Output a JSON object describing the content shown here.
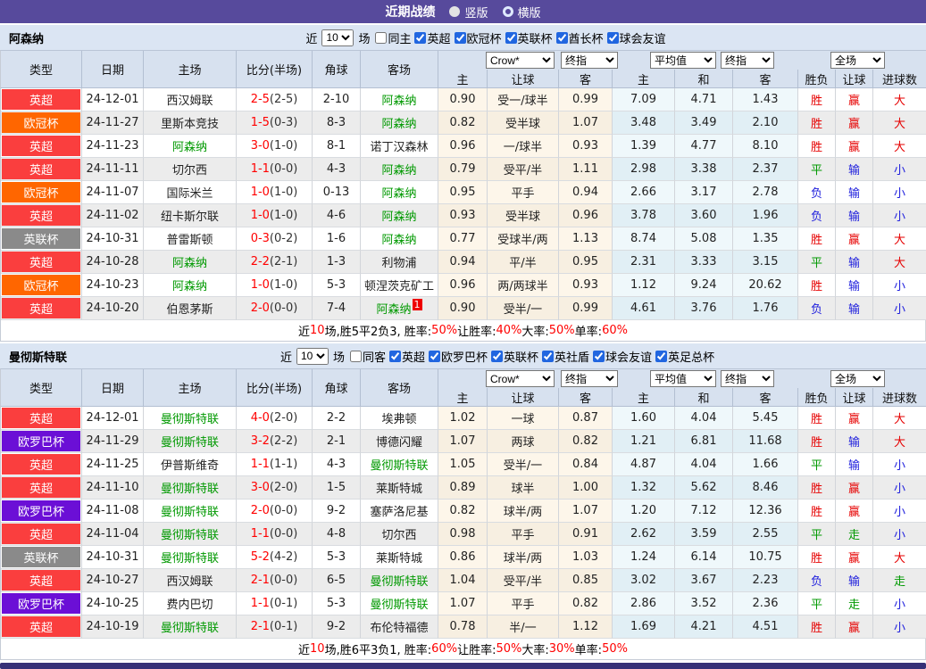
{
  "title_bar": {
    "title": "近期战绩",
    "radio_vertical": "竖版",
    "radio_horizontal": "横版"
  },
  "colors": {
    "league": {
      "英超": "#fa3e3e",
      "欧冠杯": "#ff6600",
      "英联杯": "#8a8a8a",
      "欧罗巴杯": "#6b0fd6"
    },
    "result": {
      "胜": "#e60000",
      "平": "#009900",
      "负": "#2020dd",
      "赢": "#e60000",
      "输": "#2020dd",
      "走": "#009900",
      "大": "#e60000",
      "小": "#2020dd"
    },
    "score_red": "#ff0000",
    "team_green": "#009900",
    "summary_red": "#ff0000"
  },
  "table_header": {
    "cols": [
      "类型",
      "日期",
      "主场",
      "比分(半场)",
      "角球",
      "客场"
    ],
    "odds_cols": [
      "主",
      "让球",
      "客"
    ],
    "avg_cols": [
      "主",
      "和",
      "客"
    ],
    "result_cols": [
      "胜负",
      "让球",
      "进球数"
    ],
    "dropdowns": [
      "Crow*",
      "终指",
      "平均值",
      "终指",
      "全场"
    ]
  },
  "sections": [
    {
      "team": "阿森纳",
      "filters": {
        "near_label": "近",
        "matches_value": "10",
        "field_label": "场",
        "same_label": "同主",
        "same_checked": false,
        "leagues": [
          "英超",
          "欧冠杯",
          "英联杯",
          "酋长杯",
          "球会友谊"
        ]
      },
      "rows": [
        {
          "league": "英超",
          "date": "24-12-01",
          "home": "西汉姆联",
          "score": "2-5",
          "half": "(2-5)",
          "corner": "2-10",
          "away": "阿森纳",
          "o1": "0.90",
          "handicap": "受一/球半",
          "o2": "0.99",
          "a1": "7.09",
          "a2": "4.71",
          "a3": "1.43",
          "r1": "胜",
          "r2": "赢",
          "r3": "大"
        },
        {
          "league": "欧冠杯",
          "date": "24-11-27",
          "home": "里斯本竞技",
          "score": "1-5",
          "half": "(0-3)",
          "corner": "8-3",
          "away": "阿森纳",
          "o1": "0.82",
          "handicap": "受半球",
          "o2": "1.07",
          "a1": "3.48",
          "a2": "3.49",
          "a3": "2.10",
          "r1": "胜",
          "r2": "赢",
          "r3": "大"
        },
        {
          "league": "英超",
          "date": "24-11-23",
          "home": "阿森纳",
          "score": "3-0",
          "half": "(1-0)",
          "corner": "8-1",
          "away": "诺丁汉森林",
          "o1": "0.96",
          "handicap": "一/球半",
          "o2": "0.93",
          "a1": "1.39",
          "a2": "4.77",
          "a3": "8.10",
          "r1": "胜",
          "r2": "赢",
          "r3": "大"
        },
        {
          "league": "英超",
          "date": "24-11-11",
          "home": "切尔西",
          "score": "1-1",
          "half": "(0-0)",
          "corner": "4-3",
          "away": "阿森纳",
          "o1": "0.79",
          "handicap": "受平/半",
          "o2": "1.11",
          "a1": "2.98",
          "a2": "3.38",
          "a3": "2.37",
          "r1": "平",
          "r2": "输",
          "r3": "小"
        },
        {
          "league": "欧冠杯",
          "date": "24-11-07",
          "home": "国际米兰",
          "score": "1-0",
          "half": "(1-0)",
          "corner": "0-13",
          "away": "阿森纳",
          "o1": "0.95",
          "handicap": "平手",
          "o2": "0.94",
          "a1": "2.66",
          "a2": "3.17",
          "a3": "2.78",
          "r1": "负",
          "r2": "输",
          "r3": "小"
        },
        {
          "league": "英超",
          "date": "24-11-02",
          "home": "纽卡斯尔联",
          "score": "1-0",
          "half": "(1-0)",
          "corner": "4-6",
          "away": "阿森纳",
          "o1": "0.93",
          "handicap": "受半球",
          "o2": "0.96",
          "a1": "3.78",
          "a2": "3.60",
          "a3": "1.96",
          "r1": "负",
          "r2": "输",
          "r3": "小"
        },
        {
          "league": "英联杯",
          "date": "24-10-31",
          "home": "普雷斯顿",
          "score": "0-3",
          "half": "(0-2)",
          "corner": "1-6",
          "away": "阿森纳",
          "o1": "0.77",
          "handicap": "受球半/两",
          "o2": "1.13",
          "a1": "8.74",
          "a2": "5.08",
          "a3": "1.35",
          "r1": "胜",
          "r2": "赢",
          "r3": "大"
        },
        {
          "league": "英超",
          "date": "24-10-28",
          "home": "阿森纳",
          "score": "2-2",
          "half": "(2-1)",
          "corner": "1-3",
          "away": "利物浦",
          "o1": "0.94",
          "handicap": "平/半",
          "o2": "0.95",
          "a1": "2.31",
          "a2": "3.33",
          "a3": "3.15",
          "r1": "平",
          "r2": "输",
          "r3": "大"
        },
        {
          "league": "欧冠杯",
          "date": "24-10-23",
          "home": "阿森纳",
          "score": "1-0",
          "half": "(1-0)",
          "corner": "5-3",
          "away": "顿涅茨克矿工",
          "o1": "0.96",
          "handicap": "两/两球半",
          "o2": "0.93",
          "a1": "1.12",
          "a2": "9.24",
          "a3": "20.62",
          "r1": "胜",
          "r2": "输",
          "r3": "小"
        },
        {
          "league": "英超",
          "date": "24-10-20",
          "home": "伯恩茅斯",
          "score": "2-0",
          "half": "(0-0)",
          "corner": "7-4",
          "away": "阿森纳",
          "away_sup": "1",
          "o1": "0.90",
          "handicap": "受半/一",
          "o2": "0.99",
          "a1": "4.61",
          "a2": "3.76",
          "a3": "1.76",
          "r1": "负",
          "r2": "输",
          "r3": "小"
        }
      ],
      "summary": [
        {
          "t": "近"
        },
        {
          "t": "10",
          "hl": true
        },
        {
          "t": "场,胜5平2负3, 胜率:"
        },
        {
          "t": "50%",
          "hl": true
        },
        {
          "t": " 让胜率:"
        },
        {
          "t": "40%",
          "hl": true
        },
        {
          "t": " 大率:"
        },
        {
          "t": "50%",
          "hl": true
        },
        {
          "t": " 单率:"
        },
        {
          "t": "60%",
          "hl": true
        }
      ]
    },
    {
      "team": "曼彻斯特联",
      "filters": {
        "near_label": "近",
        "matches_value": "10",
        "field_label": "场",
        "same_label": "同客",
        "same_checked": false,
        "leagues": [
          "英超",
          "欧罗巴杯",
          "英联杯",
          "英社盾",
          "球会友谊",
          "英足总杯"
        ]
      },
      "rows": [
        {
          "league": "英超",
          "date": "24-12-01",
          "home": "曼彻斯特联",
          "score": "4-0",
          "half": "(2-0)",
          "corner": "2-2",
          "away": "埃弗顿",
          "o1": "1.02",
          "handicap": "一球",
          "o2": "0.87",
          "a1": "1.60",
          "a2": "4.04",
          "a3": "5.45",
          "r1": "胜",
          "r2": "赢",
          "r3": "大"
        },
        {
          "league": "欧罗巴杯",
          "date": "24-11-29",
          "home": "曼彻斯特联",
          "score": "3-2",
          "half": "(2-2)",
          "corner": "2-1",
          "away": "博德闪耀",
          "o1": "1.07",
          "handicap": "两球",
          "o2": "0.82",
          "a1": "1.21",
          "a2": "6.81",
          "a3": "11.68",
          "r1": "胜",
          "r2": "输",
          "r3": "大"
        },
        {
          "league": "英超",
          "date": "24-11-25",
          "home": "伊普斯维奇",
          "score": "1-1",
          "half": "(1-1)",
          "corner": "4-3",
          "away": "曼彻斯特联",
          "o1": "1.05",
          "handicap": "受半/一",
          "o2": "0.84",
          "a1": "4.87",
          "a2": "4.04",
          "a3": "1.66",
          "r1": "平",
          "r2": "输",
          "r3": "小"
        },
        {
          "league": "英超",
          "date": "24-11-10",
          "home": "曼彻斯特联",
          "score": "3-0",
          "half": "(2-0)",
          "corner": "1-5",
          "away": "莱斯特城",
          "o1": "0.89",
          "handicap": "球半",
          "o2": "1.00",
          "a1": "1.32",
          "a2": "5.62",
          "a3": "8.46",
          "r1": "胜",
          "r2": "赢",
          "r3": "小"
        },
        {
          "league": "欧罗巴杯",
          "date": "24-11-08",
          "home": "曼彻斯特联",
          "score": "2-0",
          "half": "(0-0)",
          "corner": "9-2",
          "away": "塞萨洛尼基",
          "o1": "0.82",
          "handicap": "球半/两",
          "o2": "1.07",
          "a1": "1.20",
          "a2": "7.12",
          "a3": "12.36",
          "r1": "胜",
          "r2": "赢",
          "r3": "小"
        },
        {
          "league": "英超",
          "date": "24-11-04",
          "home": "曼彻斯特联",
          "score": "1-1",
          "half": "(0-0)",
          "corner": "4-8",
          "away": "切尔西",
          "o1": "0.98",
          "handicap": "平手",
          "o2": "0.91",
          "a1": "2.62",
          "a2": "3.59",
          "a3": "2.55",
          "r1": "平",
          "r2": "走",
          "r3": "小"
        },
        {
          "league": "英联杯",
          "date": "24-10-31",
          "home": "曼彻斯特联",
          "score": "5-2",
          "half": "(4-2)",
          "corner": "5-3",
          "away": "莱斯特城",
          "o1": "0.86",
          "handicap": "球半/两",
          "o2": "1.03",
          "a1": "1.24",
          "a2": "6.14",
          "a3": "10.75",
          "r1": "胜",
          "r2": "赢",
          "r3": "大"
        },
        {
          "league": "英超",
          "date": "24-10-27",
          "home": "西汉姆联",
          "score": "2-1",
          "half": "(0-0)",
          "corner": "6-5",
          "away": "曼彻斯特联",
          "o1": "1.04",
          "handicap": "受平/半",
          "o2": "0.85",
          "a1": "3.02",
          "a2": "3.67",
          "a3": "2.23",
          "r1": "负",
          "r2": "输",
          "r3": "走"
        },
        {
          "league": "欧罗巴杯",
          "date": "24-10-25",
          "home": "费内巴切",
          "score": "1-1",
          "half": "(0-1)",
          "corner": "5-3",
          "away": "曼彻斯特联",
          "o1": "1.07",
          "handicap": "平手",
          "o2": "0.82",
          "a1": "2.86",
          "a2": "3.52",
          "a3": "2.36",
          "r1": "平",
          "r2": "走",
          "r3": "小"
        },
        {
          "league": "英超",
          "date": "24-10-19",
          "home": "曼彻斯特联",
          "score": "2-1",
          "half": "(0-1)",
          "corner": "9-2",
          "away": "布伦特福德",
          "o1": "0.78",
          "handicap": "半/一",
          "o2": "1.12",
          "a1": "1.69",
          "a2": "4.21",
          "a3": "4.51",
          "r1": "胜",
          "r2": "赢",
          "r3": "小"
        }
      ],
      "summary": [
        {
          "t": "近"
        },
        {
          "t": "10",
          "hl": true
        },
        {
          "t": "场,胜6平3负1, 胜率:"
        },
        {
          "t": "60%",
          "hl": true
        },
        {
          "t": " 让胜率:"
        },
        {
          "t": "50%",
          "hl": true
        },
        {
          "t": " 大率:"
        },
        {
          "t": "30%",
          "hl": true
        },
        {
          "t": " 单率:"
        },
        {
          "t": "50%",
          "hl": true
        }
      ]
    }
  ]
}
